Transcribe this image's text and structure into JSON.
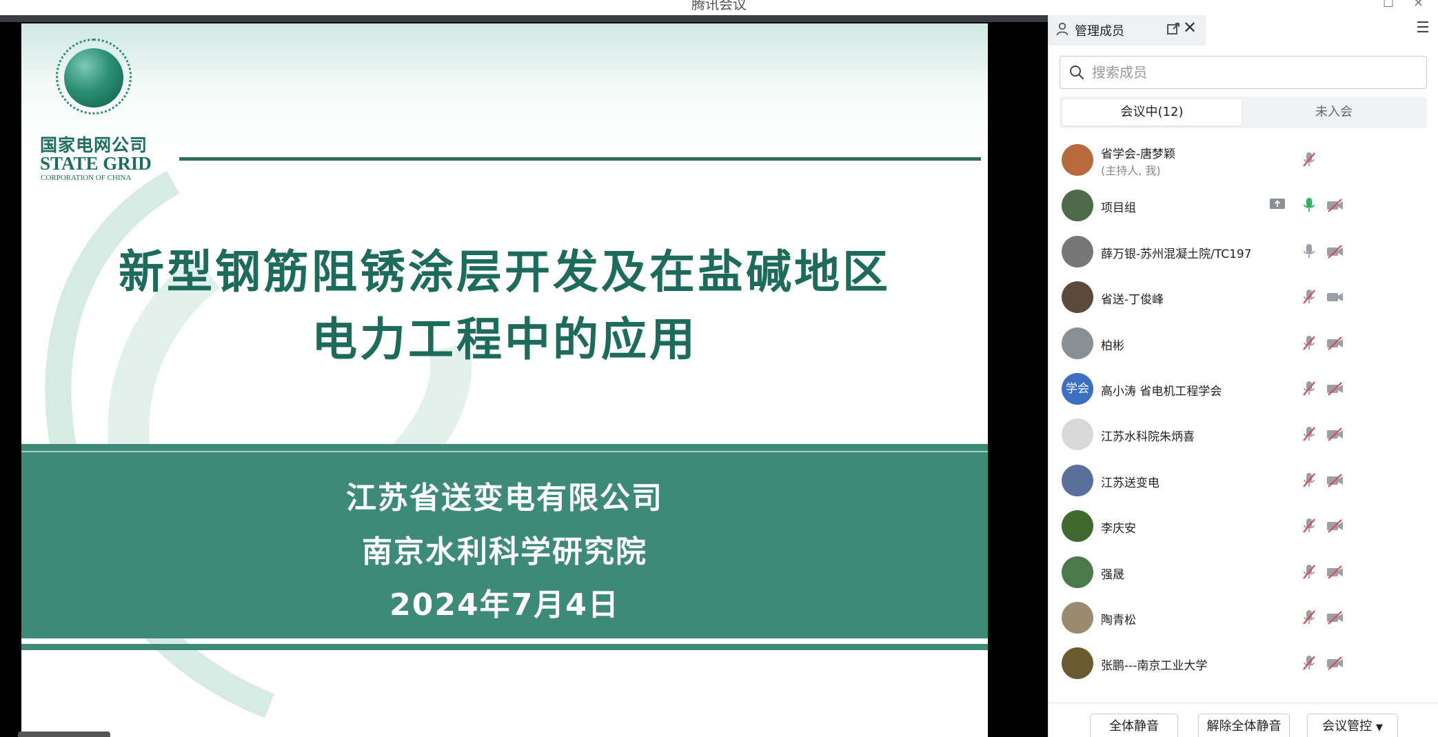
{
  "window": {
    "title": "腾讯会议"
  },
  "slide": {
    "logo_cn": "国家电网公司",
    "logo_en": "STATE GRID",
    "logo_en_sub": "CORPORATION OF CHINA",
    "title_line1": "新型钢筋阻锈涂层开发及在盐碱地区",
    "title_line2": "电力工程中的应用",
    "org_line1": "江苏省送变电有限公司",
    "org_line2": "南京水利科学研究院",
    "date": "2024年7月4日"
  },
  "panel": {
    "title": "管理成员",
    "search_placeholder": "搜索成员",
    "tabs": [
      {
        "label": "会议中(12)",
        "active": true
      },
      {
        "label": "未入会",
        "active": false
      }
    ],
    "members": [
      {
        "name": "省学会-唐梦颖",
        "role": "(主持人, 我)",
        "mic": "muted",
        "camera": "none",
        "avatar_color": "#b86a3c"
      },
      {
        "name": "项目组",
        "role": "",
        "mic": "on-green",
        "camera": "off",
        "sharing": true,
        "avatar_color": "#4f6a4a"
      },
      {
        "name": "薛万银-苏州混凝土院/TC197",
        "role": "",
        "mic": "on",
        "camera": "off",
        "avatar_color": "#777777"
      },
      {
        "name": "省送-丁俊峰",
        "role": "",
        "mic": "muted",
        "camera": "on",
        "avatar_color": "#5a4a3a"
      },
      {
        "name": "柏彬",
        "role": "",
        "mic": "muted",
        "camera": "off",
        "avatar_color": "#8a8f95"
      },
      {
        "name": "高小涛 省电机工程学会",
        "role": "",
        "mic": "muted",
        "camera": "off",
        "avatar_text": "学会",
        "avatar_color": "#3a6fc4"
      },
      {
        "name": "江苏水科院朱炳喜",
        "role": "",
        "mic": "muted",
        "camera": "off",
        "avatar_color": "#d8d8d8"
      },
      {
        "name": "江苏送变电",
        "role": "",
        "mic": "muted",
        "camera": "off",
        "avatar_color": "#5a6f9a"
      },
      {
        "name": "李庆安",
        "role": "",
        "mic": "muted",
        "camera": "off",
        "avatar_color": "#3f6a2f"
      },
      {
        "name": "强晟",
        "role": "",
        "mic": "muted",
        "camera": "off",
        "avatar_color": "#4a7a4a"
      },
      {
        "name": "陶青松",
        "role": "",
        "mic": "muted",
        "camera": "off",
        "avatar_color": "#9a8a70"
      },
      {
        "name": "张鹏---南京工业大学",
        "role": "",
        "mic": "muted",
        "camera": "off",
        "avatar_color": "#6a5a30"
      }
    ],
    "footer": {
      "mute_all": "全体静音",
      "unmute_all": "解除全体静音",
      "meeting_control": "会议管控"
    }
  },
  "colors": {
    "slide_green": "#1d6b5b",
    "band_green": "#3e8a79",
    "mic_green": "#2fb360",
    "icon_gray": "#9aa0a6"
  }
}
